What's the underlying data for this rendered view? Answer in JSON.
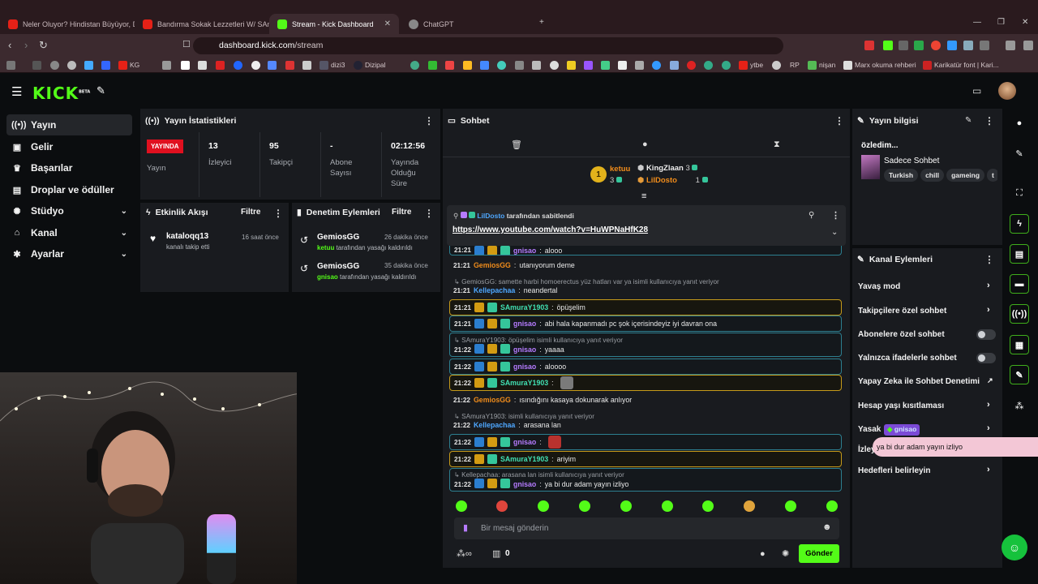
{
  "browser": {
    "tabs": [
      {
        "title": "Neler Oluyor? Hindistan Büyüyor, Dü",
        "color": "#e62117"
      },
      {
        "title": "Bandırma Sokak Lezzetleri W/ SAmu",
        "color": "#e62117"
      },
      {
        "title": "Stream - Kick Dashboard",
        "color": "#53fc18"
      },
      {
        "title": "ChatGPT",
        "color": "#aaaaaa"
      }
    ],
    "url_host": "dashboard.kick.com",
    "url_path": "/stream",
    "bookmarks": [
      "KG",
      "dizi3",
      "Dizipal",
      "ytbe",
      "RP",
      "nişan",
      "Marx okuma rehberi",
      "Karikatür font | Kari..."
    ]
  },
  "header": {
    "logo": "KICK",
    "logo_sup": "BETA"
  },
  "sidebar": {
    "items": [
      {
        "label": "Yayın",
        "icon": "broadcast-icon"
      },
      {
        "label": "Gelir",
        "icon": "wallet-icon"
      },
      {
        "label": "Başarılar",
        "icon": "trophy-icon"
      },
      {
        "label": "Droplar ve ödüller",
        "icon": "gift-icon"
      },
      {
        "label": "Stüdyo",
        "icon": "gear-icon"
      },
      {
        "label": "Kanal",
        "icon": "home-icon"
      },
      {
        "label": "Ayarlar",
        "icon": "settings-icon"
      }
    ]
  },
  "stats": {
    "title": "Yayın İstatistikleri",
    "live_badge": "YAYINDA",
    "live_label": "Yayın",
    "viewers": "13",
    "viewers_label": "İzleyici",
    "followers": "95",
    "followers_label": "Takipçi",
    "subs": "-",
    "subs_label": "Abone Sayısı",
    "uptime": "02:12:56",
    "uptime_label": "Yayında Olduğu Süre"
  },
  "activity": {
    "title": "Etkinlik Akışı",
    "filter": "Filtre",
    "items": [
      {
        "name": "kataloqq13",
        "action": "kanalı takip etti",
        "time": "16 saat önce"
      }
    ]
  },
  "moderation": {
    "title": "Denetim Eylemleri",
    "filter": "Filtre",
    "items": [
      {
        "name": "GemiosGG",
        "target": "ketuu",
        "action": "tarafından yasağı kaldırıldı",
        "time": "26 dakika önce"
      },
      {
        "name": "GemiosGG",
        "target": "gnisao",
        "action": "tarafından yasağı kaldırıldı",
        "time": "35 dakika önce"
      }
    ]
  },
  "chat": {
    "title": "Sohbet",
    "leaders": {
      "first": "ketuu",
      "first_count": "3",
      "second": "KingZlaan",
      "second_count": "3",
      "third": "LilDosto",
      "third_count": "1",
      "rank": "1"
    },
    "pinned": {
      "user": "LilDosto",
      "text": "tarafından sabitlendi",
      "link": "https://www.youtube.com/watch?v=HuWPNaHfK28"
    },
    "messages": [
      {
        "time": "21:21",
        "user": "gnisao",
        "text": "alooo"
      },
      {
        "time": "21:21",
        "user": "GemiosGG",
        "text": "utanıyorum deme"
      },
      {
        "reply": "GemiosGG: samette harbi homoerectus yüz hatları var ya isimli kullanıcıya yanıt veriyor"
      },
      {
        "time": "21:21",
        "user": "Kellepachaa",
        "text": "neandertal"
      },
      {
        "time": "21:21",
        "user": "SAmuraY1903",
        "text": "öpüşelim"
      },
      {
        "time": "21:21",
        "user": "gnisao",
        "text": "abi hala kapanmadı pc şok içerisindeyiz iyi davran ona"
      },
      {
        "reply": "SAmuraY1903: öpüşelim isimli kullanıcıya yanıt veriyor"
      },
      {
        "time": "21:22",
        "user": "gnisao",
        "text": "yaaaa"
      },
      {
        "time": "21:22",
        "user": "gnisao",
        "text": "aloooo"
      },
      {
        "time": "21:22",
        "user": "SAmuraY1903",
        "text": ""
      },
      {
        "time": "21:22",
        "user": "GemiosGG",
        "text": "ısındığını kasaya dokunarak anlıyor"
      },
      {
        "reply": "SAmuraY1903: isimli kullanıcıya yanıt veriyor"
      },
      {
        "time": "21:22",
        "user": "Kellepachaa",
        "text": "arasana lan"
      },
      {
        "time": "21:22",
        "user": "gnisao",
        "text": ""
      },
      {
        "time": "21:22",
        "user": "SAmuraY1903",
        "text": "ariyim"
      },
      {
        "reply": "Kellepachaa: arasana lan isimli kullanıcıya yanıt veriyor"
      },
      {
        "time": "21:22",
        "user": "gnisao",
        "text": "ya bi dur adam yayın izliyo"
      }
    ],
    "input_placeholder": "Bir mesaj gönderin",
    "points": "0",
    "send": "Gönder"
  },
  "stream_info": {
    "title": "Yayın bilgisi",
    "stream_title": "özledim...",
    "category": "Sadece Sohbet",
    "tags": [
      "Turkish",
      "chill",
      "gameing",
      "t"
    ]
  },
  "channel_actions": {
    "title": "Kanal Eylemleri",
    "items": [
      {
        "label": "Yavaş mod",
        "type": "arrow"
      },
      {
        "label": "Takipçilere özel sohbet",
        "type": "arrow"
      },
      {
        "label": "Abonelere özel sohbet",
        "type": "toggle"
      },
      {
        "label": "Yalnızca ifadelerle sohbet",
        "type": "toggle"
      },
      {
        "label": "Yapay Zeka ile Sohbet Denetimi",
        "type": "external"
      },
      {
        "label": "Hesap yaşı kısıtlaması",
        "type": "arrow"
      },
      {
        "label": "Yasak",
        "type": "arrow"
      },
      {
        "label": "İzley",
        "type": "none"
      },
      {
        "label": "Hedefleri belirleyin",
        "type": "arrow"
      }
    ]
  },
  "overlay": {
    "user": "gnisao",
    "text": "ya bi dur adam yayın izliyo"
  }
}
